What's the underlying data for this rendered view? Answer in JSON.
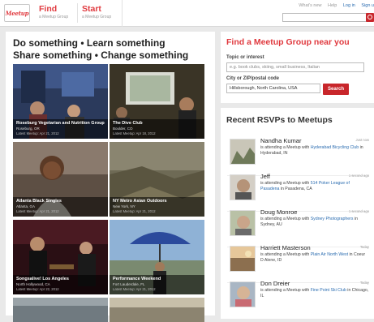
{
  "header": {
    "logo_text": "Meetup",
    "find": {
      "title": "Find",
      "subtitle": "a Meetup Group"
    },
    "start": {
      "title": "Start",
      "subtitle": "a Meetup Group"
    },
    "nav": {
      "whats_new": "What's new",
      "help": "Help",
      "login": "Log in",
      "signup": "Sign u"
    }
  },
  "hero": {
    "line1": "Do something • Learn something",
    "line2": "Share something • Change something"
  },
  "groups": [
    {
      "name": "Roseburg Vegetarian and Nutrition Group",
      "location": "Roseburg, OR",
      "latest": "Latest Meetup: Apr 21, 2012"
    },
    {
      "name": "The Dive Club",
      "location": "Boulder, CO",
      "latest": "Latest Meetup: Apr 18, 2012"
    },
    {
      "name": "Atlanta Black Singles",
      "location": "Atlanta, GA",
      "latest": "Latest Meetup: Apr 21, 2012"
    },
    {
      "name": "NY Metro Asian Outdoors",
      "location": "New York, NY",
      "latest": "Latest Meetup: Apr 21, 2012"
    },
    {
      "name": "Songsalive! Los Angeles",
      "location": "North Hollywood, CA",
      "latest": "Latest Meetup: Apr 22, 2012"
    },
    {
      "name": "Performance Weekend",
      "location": "Fort Lauderdale, FL",
      "latest": "Latest Meetup: Apr 21, 2012"
    }
  ],
  "find_panel": {
    "title": "Find a Meetup Group near you",
    "topic_label": "Topic or interest",
    "topic_placeholder": "e.g. book clubs, skiing, small business, Italian",
    "city_label": "City or ZIP/postal code",
    "city_value": "Hillsborough, North Carolina, USA",
    "search_label": "Search"
  },
  "rsvp_panel": {
    "title": "Recent RSVPs to Meetups",
    "items": [
      {
        "name": "Nandha Kumar",
        "time": "Just now",
        "text": "is attending a Meetup with ",
        "group": "Hyderabad Bicycling Club",
        "place": " in Hyderabad, IN"
      },
      {
        "name": "Jeff",
        "time": "1 second ago",
        "text": "is attending a Meetup with ",
        "group": "514 Poker League of Pasadena",
        "place": " in Pasadena, CA"
      },
      {
        "name": "Doug Monroe",
        "time": "1 second ago",
        "text": "is attending a Meetup with ",
        "group": "Sydney Photographers",
        "place": " in Sydney, AU"
      },
      {
        "name": "Harriett Masterson",
        "time": "Today",
        "text": "is attending a Meetup with ",
        "group": "Plain Air North West",
        "place": " in Coeur D Alene, ID"
      },
      {
        "name": "Don Dreier",
        "time": "Today",
        "text": "is attending a Meetup with ",
        "group": "Fine Point Ski Club",
        "place": " in Chicago, IL"
      }
    ]
  }
}
